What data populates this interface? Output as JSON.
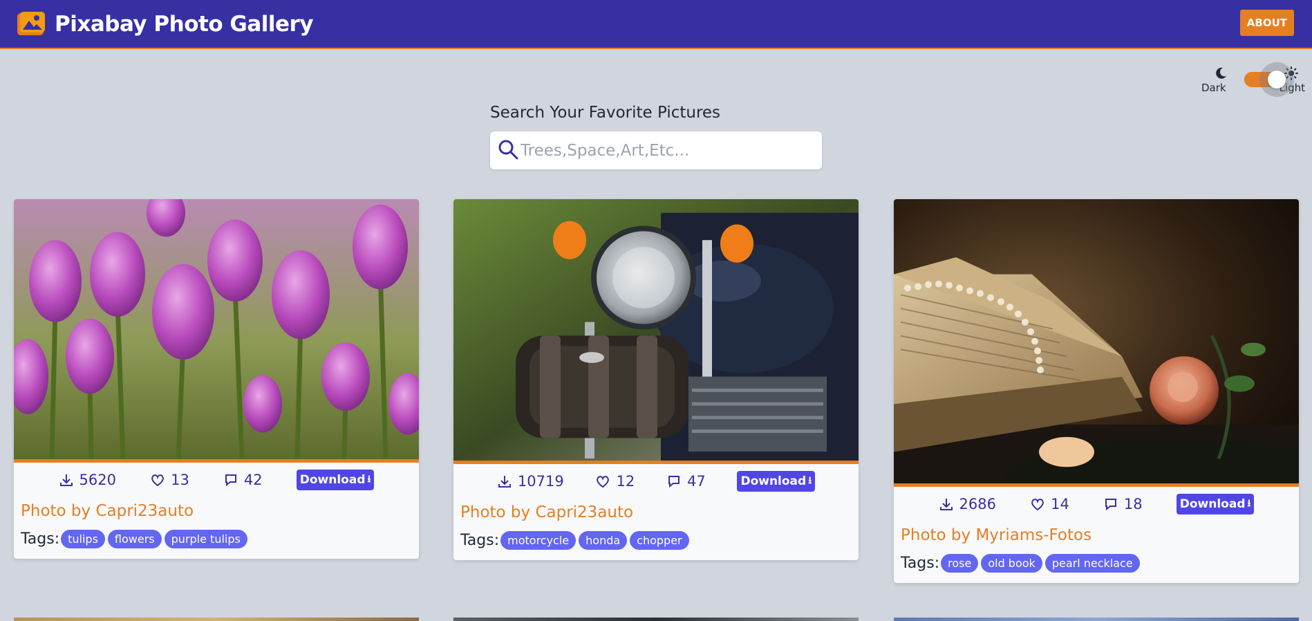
{
  "header": {
    "title": "Pixabay Photo Gallery",
    "about_label": "ABOUT",
    "brand_color": "#3730a3",
    "accent_color": "#e67e22"
  },
  "theme_toggle": {
    "dark_label": "Dark",
    "light_label": "Light",
    "state": "light"
  },
  "search": {
    "heading": "Search Your Favorite Pictures",
    "placeholder": "Trees,Space,Art,Etc...",
    "value": ""
  },
  "cards": [
    {
      "downloads": "5620",
      "likes": "13",
      "comments": "42",
      "download_label": "Download",
      "photographer": "Photo by Capri23auto",
      "tags_label": "Tags:",
      "tags": [
        "tulips",
        "flowers",
        "purple tulips"
      ],
      "image_icon": "tulips-photo"
    },
    {
      "downloads": "10719",
      "likes": "12",
      "comments": "47",
      "download_label": "Download",
      "photographer": "Photo by Capri23auto",
      "tags_label": "Tags:",
      "tags": [
        "motorcycle",
        "honda",
        "chopper"
      ],
      "image_icon": "motorcycle-photo"
    },
    {
      "downloads": "2686",
      "likes": "14",
      "comments": "18",
      "download_label": "Download",
      "photographer": "Photo by Myriams-Fotos",
      "tags_label": "Tags:",
      "tags": [
        "rose",
        "old book",
        "pearl necklace"
      ],
      "image_icon": "rose-book-photo"
    }
  ]
}
